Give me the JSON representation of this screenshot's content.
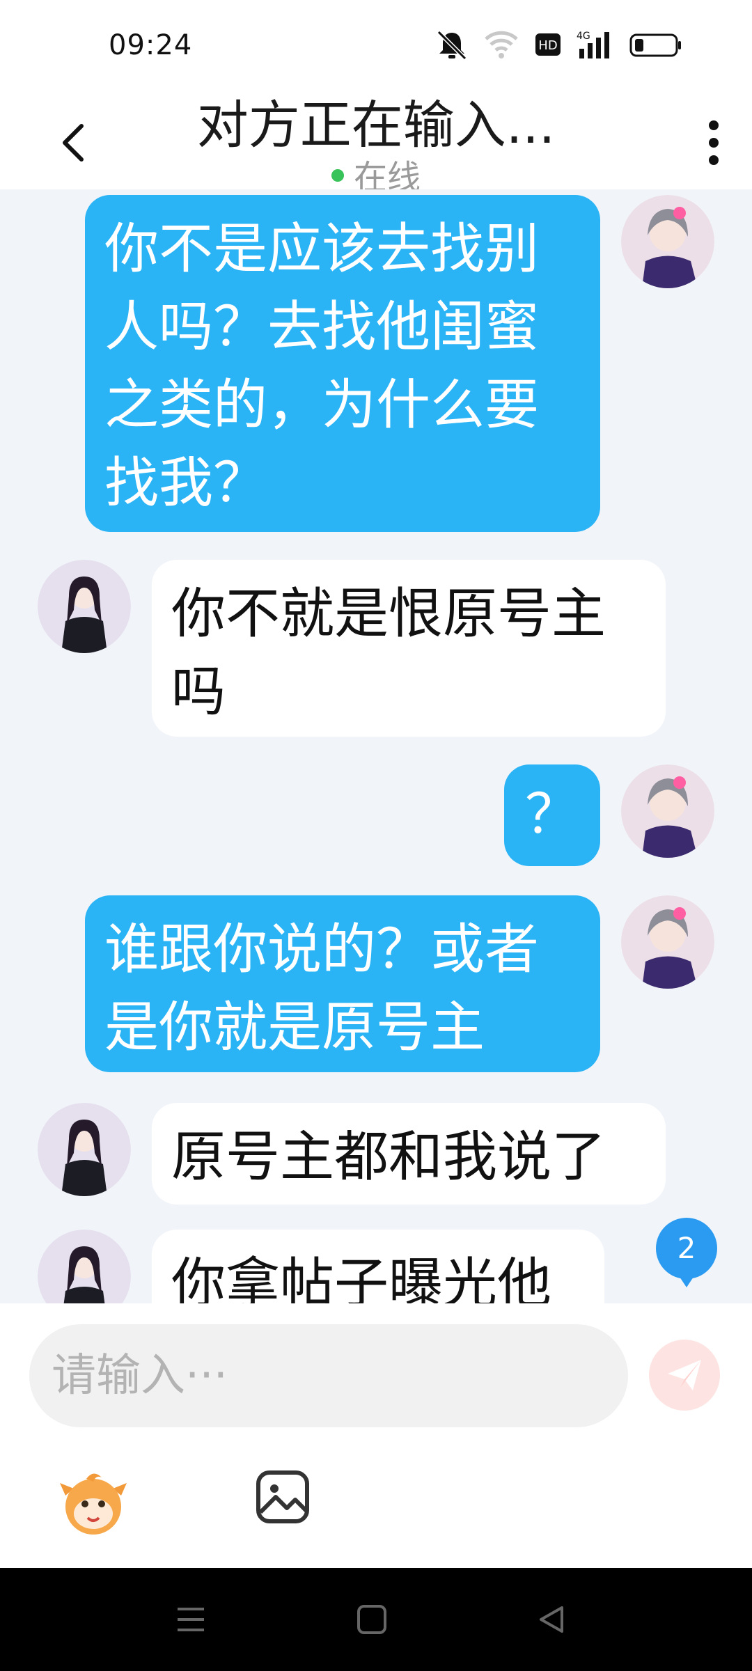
{
  "status_bar": {
    "time": "09:24",
    "icons": [
      "mute-bell-icon",
      "wifi-icon",
      "hd-icon",
      "4g-signal-icon",
      "battery-icon"
    ],
    "hd_label": "HD",
    "network_label": "4G"
  },
  "header": {
    "title": "对方正在输入...",
    "status": "在线",
    "status_color": "#37c25a"
  },
  "messages": [
    {
      "side": "me",
      "text": "你不是应该去找别人吗？去找他闺蜜之类的，为什么要找我？"
    },
    {
      "side": "other",
      "text": "你不就是恨原号主吗"
    },
    {
      "side": "me",
      "text": "？"
    },
    {
      "side": "me",
      "text": "谁跟你说的？或者是你就是原号主"
    },
    {
      "side": "other",
      "text": "原号主都和我说了"
    },
    {
      "side": "other",
      "text": "你拿帖子曝光他"
    }
  ],
  "unread_badge": "2",
  "input": {
    "placeholder": "请输入···"
  },
  "colors": {
    "outgoing_bubble": "#2ab4f6",
    "incoming_bubble": "#ffffff",
    "chat_background": "#f1f4f9",
    "send_button": "#fde3e1",
    "badge": "#2a9bf0"
  }
}
